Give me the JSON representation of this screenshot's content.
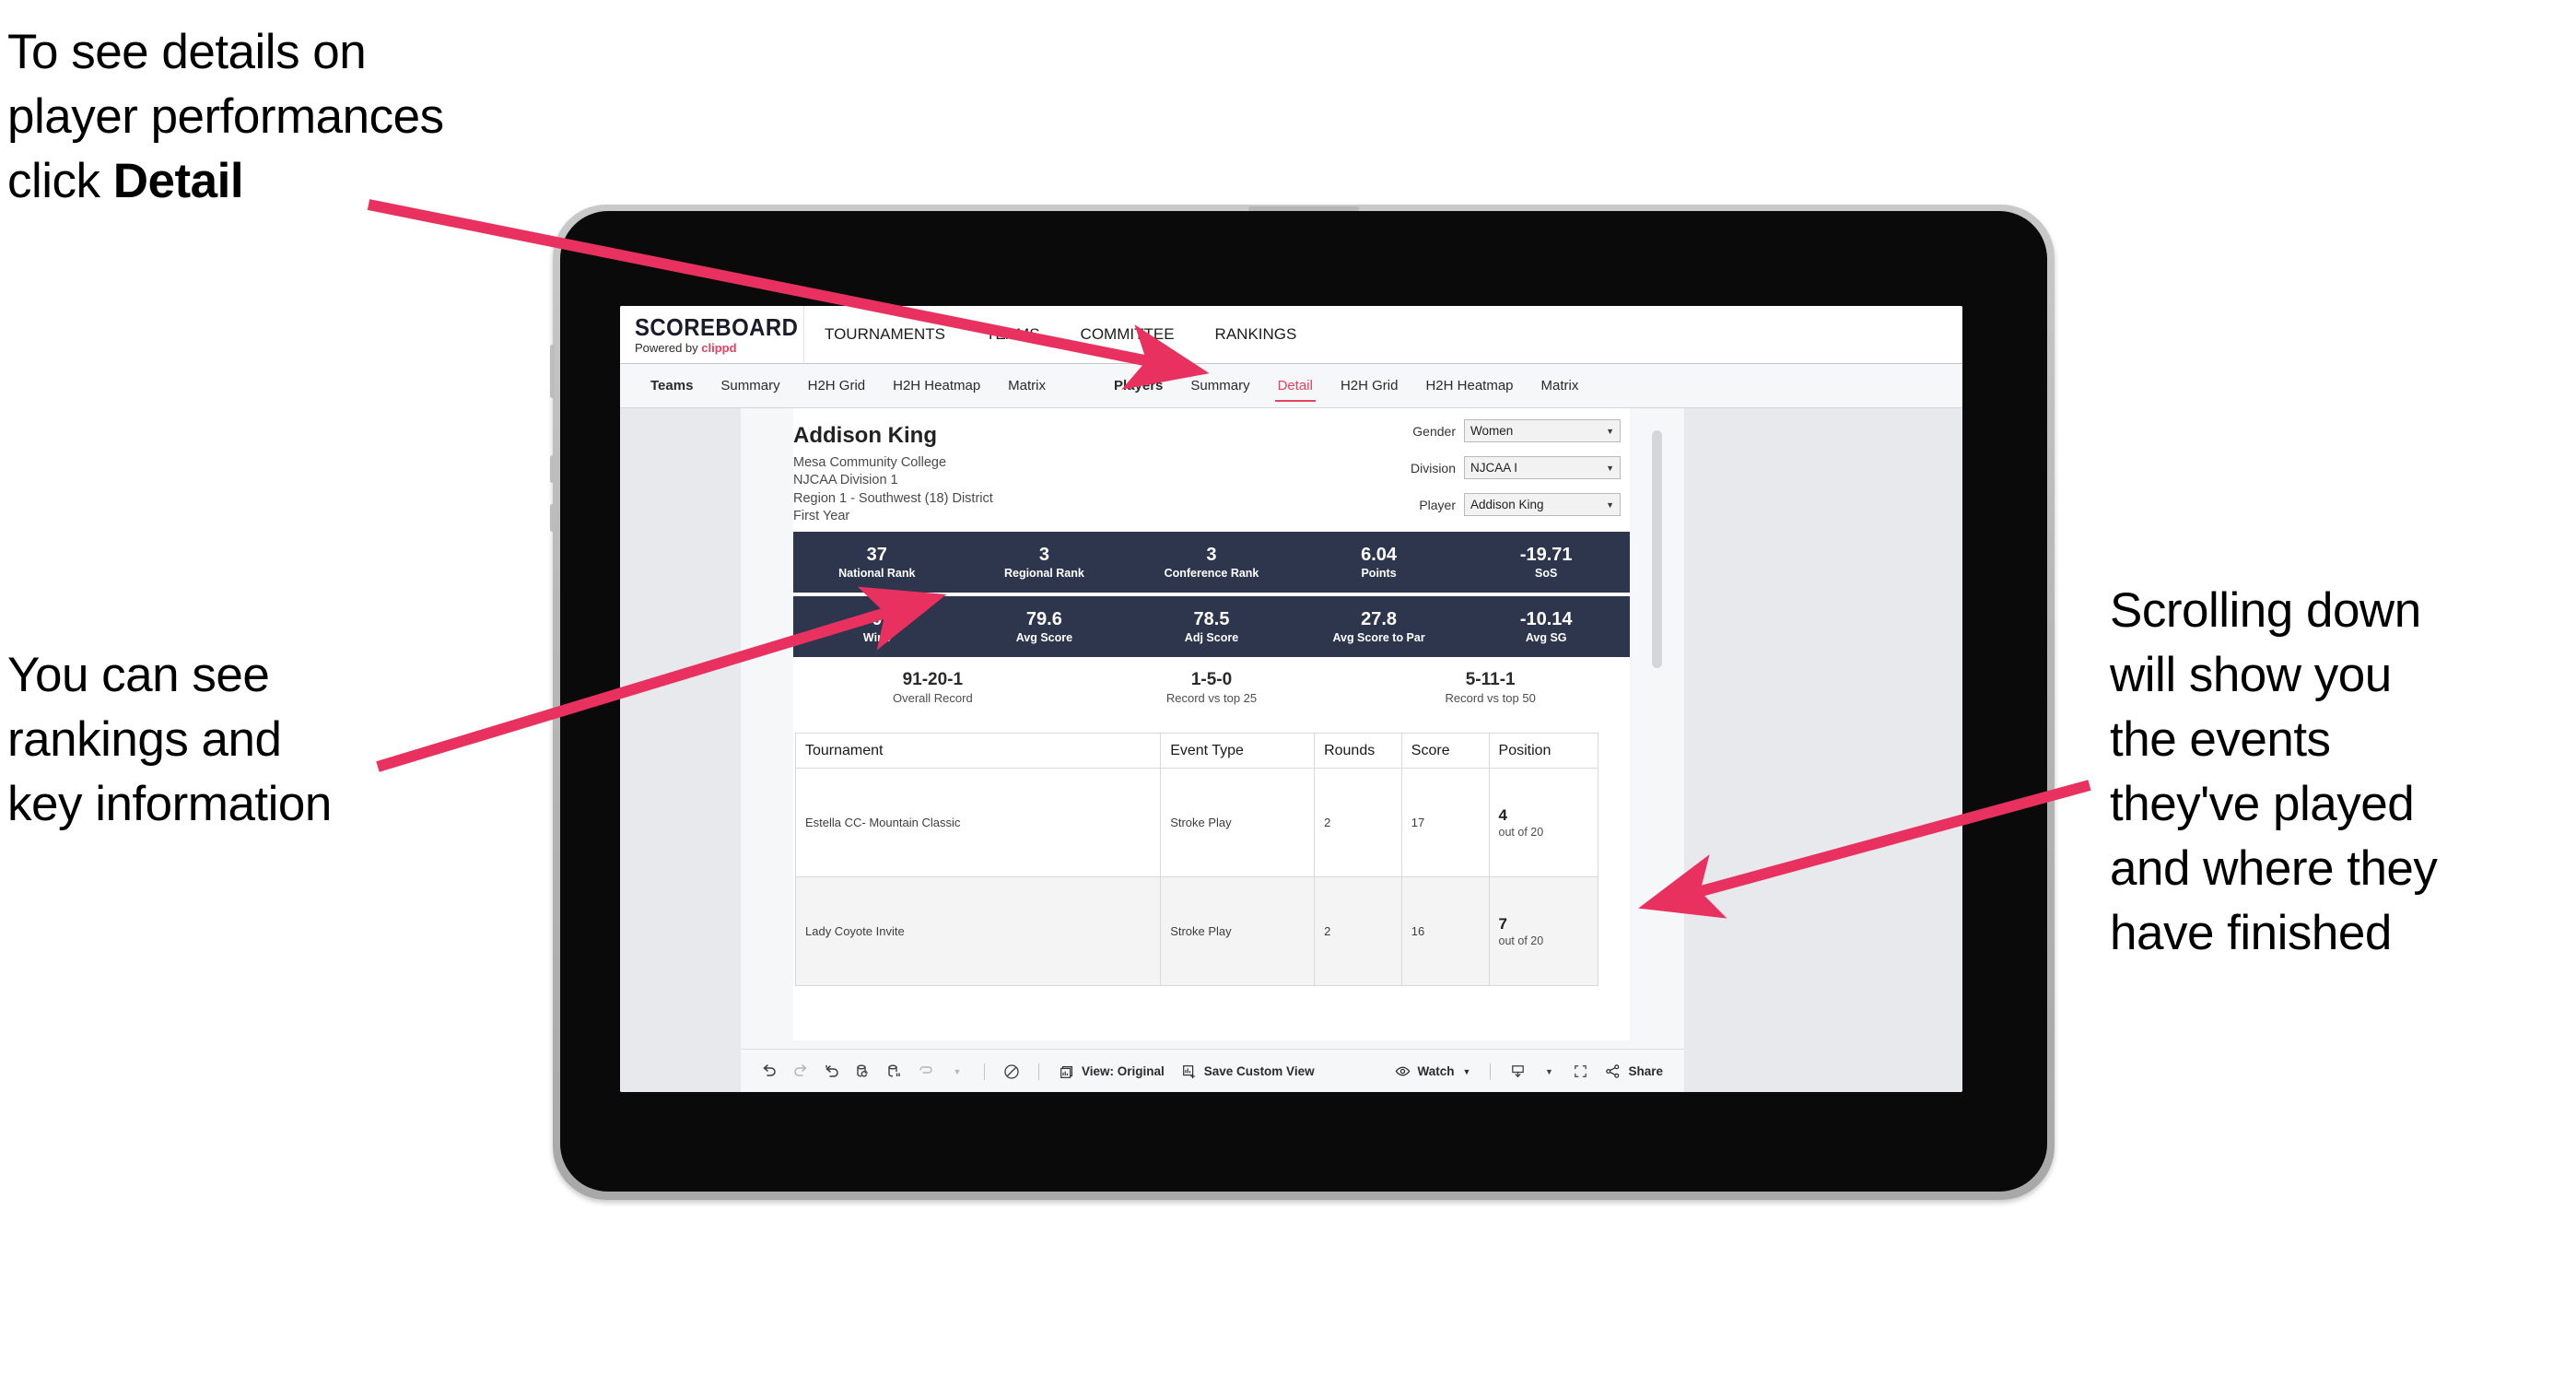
{
  "annotations": {
    "top_left": "To see details on\nplayer performances\nclick ",
    "top_left_bold": "Detail",
    "mid_left": "You can see\nrankings and\nkey information",
    "right": "Scrolling down\nwill show you\nthe events\nthey've played\nand where they\nhave finished"
  },
  "colors": {
    "accent_pink": "#e8415e",
    "stat_band": "#2e364e",
    "canvas_gray": "#e7e9ec"
  },
  "app": {
    "logo": {
      "main": "SCOREBOARD",
      "powered_prefix": "Powered by ",
      "brand": "clippd"
    },
    "topnav": [
      {
        "label": "TOURNAMENTS"
      },
      {
        "label": "TEAMS"
      },
      {
        "label": "COMMITTEE"
      },
      {
        "label": "RANKINGS"
      }
    ],
    "subnav": {
      "teams_group": [
        {
          "label": "Teams",
          "active": false,
          "head": true
        },
        {
          "label": "Summary",
          "active": false,
          "head": false
        },
        {
          "label": "H2H Grid",
          "active": false,
          "head": false
        },
        {
          "label": "H2H Heatmap",
          "active": false,
          "head": false
        },
        {
          "label": "Matrix",
          "active": false,
          "head": false
        }
      ],
      "players_group": [
        {
          "label": "Players",
          "active": false,
          "head": true
        },
        {
          "label": "Summary",
          "active": false,
          "head": false
        },
        {
          "label": "Detail",
          "active": true,
          "head": false
        },
        {
          "label": "H2H Grid",
          "active": false,
          "head": false
        },
        {
          "label": "H2H Heatmap",
          "active": false,
          "head": false
        },
        {
          "label": "Matrix",
          "active": false,
          "head": false
        }
      ]
    }
  },
  "player": {
    "name": "Addison King",
    "school": "Mesa Community College",
    "division": "NJCAA Division 1",
    "region": "Region 1 - Southwest (18) District",
    "year": "First Year"
  },
  "filters": [
    {
      "label": "Gender",
      "value": "Women"
    },
    {
      "label": "Division",
      "value": "NJCAA I"
    },
    {
      "label": "Player",
      "value": "Addison King"
    }
  ],
  "stats_row_1": [
    {
      "value": "37",
      "label": "National Rank"
    },
    {
      "value": "3",
      "label": "Regional Rank"
    },
    {
      "value": "3",
      "label": "Conference Rank"
    },
    {
      "value": "6.04",
      "label": "Points"
    },
    {
      "value": "-19.71",
      "label": "SoS"
    }
  ],
  "stats_row_2": [
    {
      "value": "0",
      "label": "Wins"
    },
    {
      "value": "79.6",
      "label": "Avg Score"
    },
    {
      "value": "78.5",
      "label": "Adj Score"
    },
    {
      "value": "27.8",
      "label": "Avg Score to Par"
    },
    {
      "value": "-10.14",
      "label": "Avg SG"
    }
  ],
  "records": [
    {
      "value": "91-20-1",
      "label": "Overall Record"
    },
    {
      "value": "1-5-0",
      "label": "Record vs top 25"
    },
    {
      "value": "5-11-1",
      "label": "Record vs top 50"
    }
  ],
  "table": {
    "headers": [
      "Tournament",
      "Event Type",
      "Rounds",
      "Score",
      "Position"
    ],
    "rows": [
      {
        "tournament": "Estella CC- Mountain Classic",
        "event_type": "Stroke Play",
        "rounds": "2",
        "score": "17",
        "position_num": "4",
        "position_sub": "out of 20"
      },
      {
        "tournament": "Lady Coyote Invite",
        "event_type": "Stroke Play",
        "rounds": "2",
        "score": "16",
        "position_num": "7",
        "position_sub": "out of 20"
      }
    ]
  },
  "toolbar": {
    "view_label": "View: Original",
    "save_label": "Save Custom View",
    "watch_label": "Watch",
    "share_label": "Share"
  }
}
